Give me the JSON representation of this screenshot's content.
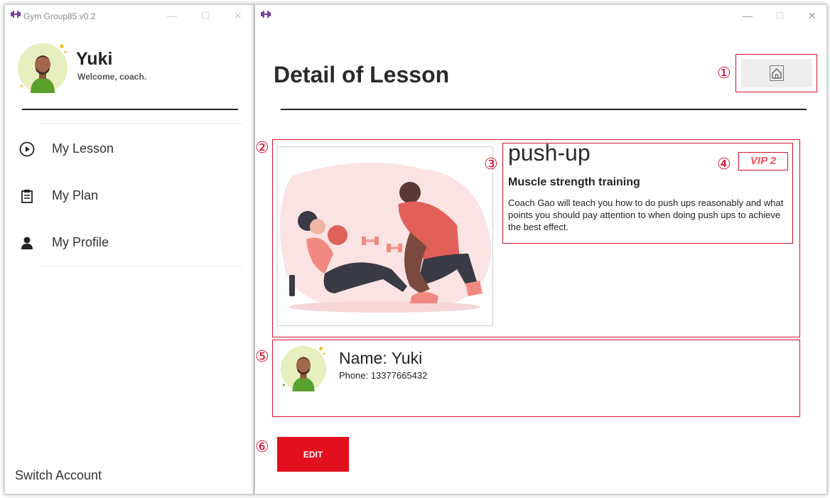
{
  "left_window": {
    "title": "Gym Group85 v0.2",
    "controls": {
      "minimize": "—",
      "maximize": "☐",
      "close": "✕"
    }
  },
  "user": {
    "name": "Yuki",
    "welcome": "Welcome, coach."
  },
  "sidebar": {
    "items": [
      {
        "label": "My Lesson",
        "icon": "play-circle-icon"
      },
      {
        "label": "My Plan",
        "icon": "clipboard-icon"
      },
      {
        "label": "My Profile",
        "icon": "person-icon"
      }
    ],
    "switch_account": "Switch Account"
  },
  "right_window": {
    "controls": {
      "minimize": "—",
      "maximize": "☐",
      "close": "✕"
    }
  },
  "page": {
    "title": "Detail of Lesson",
    "home_icon": "home-icon"
  },
  "lesson": {
    "title": "push-up",
    "badge": "VIP 2",
    "subtitle": "Muscle strength training",
    "description": "Coach Gao will teach you how to do push ups reasonably and what points you should pay attention to when doing push ups to achieve the best effect."
  },
  "coach": {
    "name_line": "Name: Yuki",
    "phone_line": "Phone: 13377665432"
  },
  "actions": {
    "edit_label": "EDIT"
  },
  "annotations": [
    "①",
    "②",
    "③",
    "④",
    "⑤",
    "⑥"
  ],
  "colors": {
    "accent_red": "#e2101f",
    "annotation_red": "#d8102b",
    "avatar_bg": "#e6efbd",
    "logo_purple": "#7b3fa0"
  }
}
